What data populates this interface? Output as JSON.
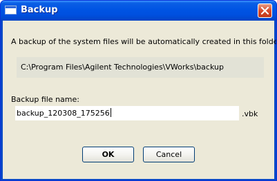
{
  "window": {
    "title": "Backup",
    "close_icon": "close-icon"
  },
  "dialog": {
    "info_text": "A backup of the system files will be automatically created in this folder:",
    "folder_path": "C:\\Program Files\\Agilent Technologies\\VWorks\\backup",
    "file_name_label": "Backup file name:",
    "file_name_value": "backup_120308_175256",
    "file_extension": ".vbk"
  },
  "buttons": {
    "ok_label": "OK",
    "cancel_label": "Cancel"
  },
  "colors": {
    "titlebar": "#0054e3",
    "close_button": "#d7492b",
    "client_background": "#ece9d8"
  }
}
